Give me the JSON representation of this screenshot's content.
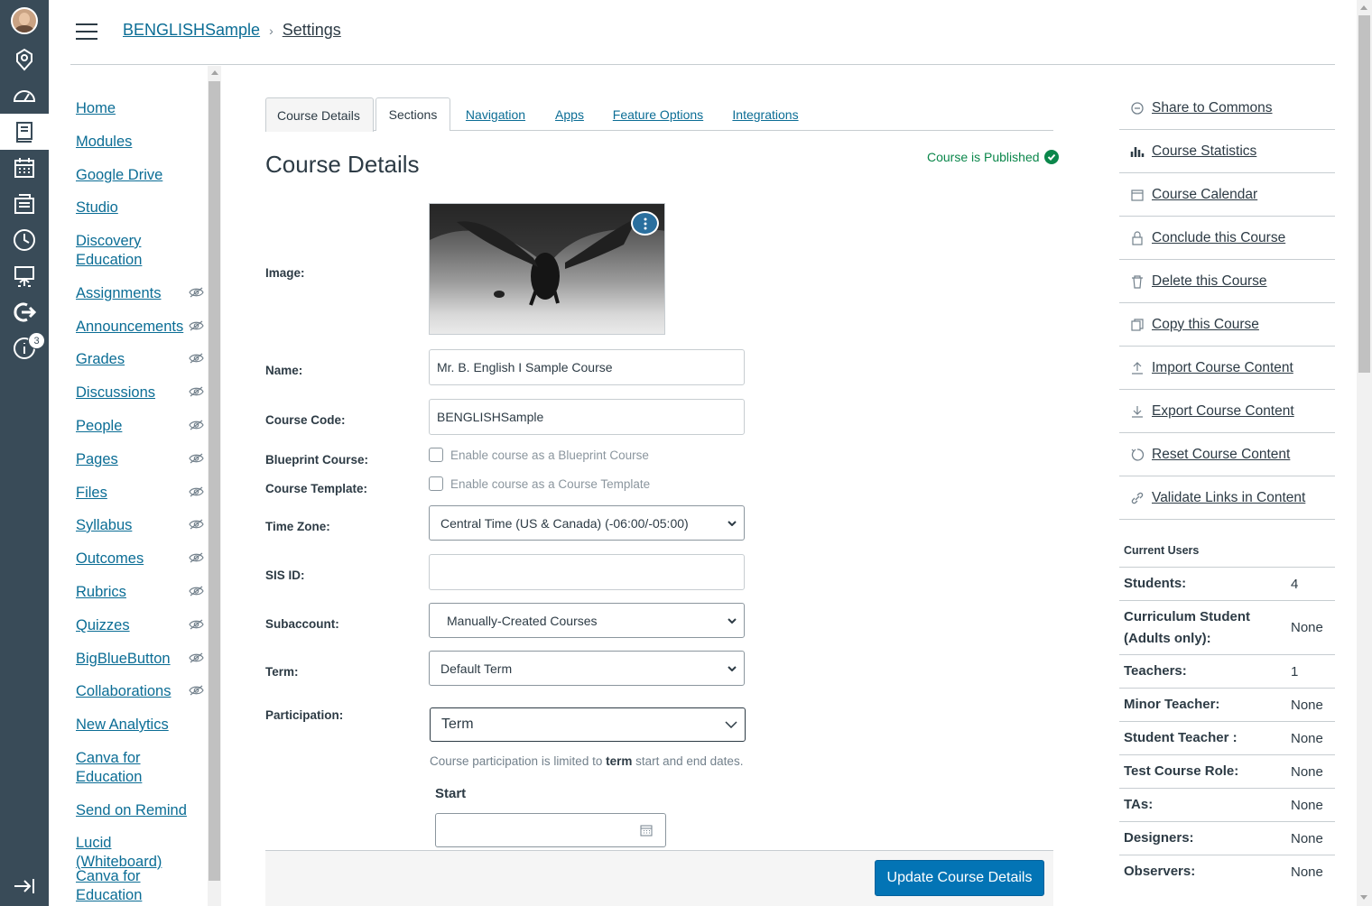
{
  "breadcrumb": {
    "course": "BENGLISHSample",
    "page": "Settings"
  },
  "global_nav": {
    "badge": "3"
  },
  "course_nav": [
    {
      "label": "Home",
      "hidden": false
    },
    {
      "label": "Modules",
      "hidden": false
    },
    {
      "label": "Google Drive",
      "hidden": false
    },
    {
      "label": "Studio",
      "hidden": false
    },
    {
      "label": "Discovery Education",
      "hidden": false
    },
    {
      "label": "Assignments",
      "hidden": true
    },
    {
      "label": "Announcements",
      "hidden": true
    },
    {
      "label": "Grades",
      "hidden": true
    },
    {
      "label": "Discussions",
      "hidden": true
    },
    {
      "label": "People",
      "hidden": true
    },
    {
      "label": "Pages",
      "hidden": true
    },
    {
      "label": "Files",
      "hidden": true
    },
    {
      "label": "Syllabus",
      "hidden": true
    },
    {
      "label": "Outcomes",
      "hidden": true
    },
    {
      "label": "Rubrics",
      "hidden": true
    },
    {
      "label": "Quizzes",
      "hidden": true
    },
    {
      "label": "BigBlueButton",
      "hidden": true
    },
    {
      "label": "Collaborations",
      "hidden": true
    },
    {
      "label": "New Analytics",
      "hidden": false
    },
    {
      "label": "Canva for Education",
      "hidden": false
    },
    {
      "label": "Send on Remind",
      "hidden": false
    },
    {
      "label": "Lucid (Whiteboard)",
      "hidden": false
    },
    {
      "label": "Canva for Education",
      "hidden": false
    }
  ],
  "tabs": [
    "Course Details",
    "Sections",
    "Navigation",
    "Apps",
    "Feature Options",
    "Integrations"
  ],
  "main": {
    "title": "Course Details",
    "published": "Course is Published",
    "labels": {
      "image": "Image:",
      "name": "Name:",
      "code": "Course Code:",
      "blueprint": "Blueprint Course:",
      "template": "Course Template:",
      "timezone": "Time Zone:",
      "sis": "SIS ID:",
      "subaccount": "Subaccount:",
      "term": "Term:",
      "participation": "Participation:"
    },
    "name_value": "Mr. B. English I Sample Course",
    "code_value": "BENGLISHSample",
    "blueprint_option": "Enable course as a Blueprint Course",
    "template_option": "Enable course as a Course Template",
    "timezone_value": "Central Time (US & Canada) (-06:00/-05:00)",
    "sis_value": "",
    "subaccount_value": "Manually-Created Courses",
    "term_value": "Default Term",
    "participation_value": "Term",
    "note_before": "Course participation is limited to ",
    "note_bold": "term",
    "note_after": " start and end dates.",
    "start_label": "Start",
    "update_button": "Update Course Details"
  },
  "aside_links": [
    {
      "label": "Share to Commons",
      "icon": "commons-icon"
    },
    {
      "label": "Course Statistics",
      "icon": "stats-icon"
    },
    {
      "label": "Course Calendar",
      "icon": "calendar-icon"
    },
    {
      "label": "Conclude this Course",
      "icon": "lock-icon"
    },
    {
      "label": "Delete this Course",
      "icon": "trash-icon"
    },
    {
      "label": "Copy this Course",
      "icon": "copy-icon"
    },
    {
      "label": "Import Course Content",
      "icon": "upload-icon"
    },
    {
      "label": "Export Course Content",
      "icon": "download-icon"
    },
    {
      "label": "Reset Course Content",
      "icon": "reset-icon"
    },
    {
      "label": "Validate Links in Content",
      "icon": "link-icon"
    }
  ],
  "current_users": {
    "title": "Current Users",
    "rows": [
      {
        "k": "Students:",
        "v": "4"
      },
      {
        "k": "Curriculum Student (Adults only):",
        "v": "None"
      },
      {
        "k": "Teachers:",
        "v": "1"
      },
      {
        "k": "Minor Teacher:",
        "v": "None"
      },
      {
        "k": "Student Teacher :",
        "v": "None"
      },
      {
        "k": "Test Course Role:",
        "v": "None"
      },
      {
        "k": "TAs:",
        "v": "None"
      },
      {
        "k": "Designers:",
        "v": "None"
      },
      {
        "k": "Observers:",
        "v": "None"
      }
    ]
  }
}
